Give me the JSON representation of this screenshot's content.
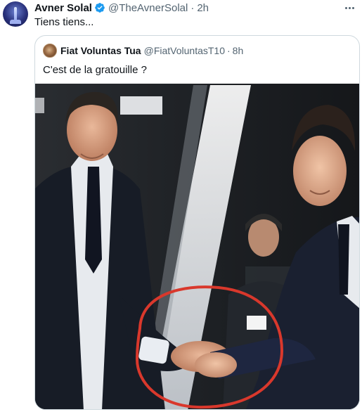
{
  "tweet": {
    "author_name": "Avner Solal",
    "author_handle": "@TheAvnerSolal",
    "separator": "·",
    "time": "2h",
    "text": "Tiens tiens...",
    "verified_icon": "verified-badge-icon",
    "more_icon": "more-options-icon"
  },
  "quote": {
    "author_name": "Fiat Voluntas Tua",
    "author_handle": "@FiatVoluntasT10",
    "separator": "·",
    "time": "8h",
    "text": "C'est de la gratouille ?"
  },
  "colors": {
    "text_primary": "#0f1419",
    "text_secondary": "#536471",
    "verified": "#1d9bf0",
    "border": "#cfd9de",
    "annotation_circle": "#d9382c"
  }
}
